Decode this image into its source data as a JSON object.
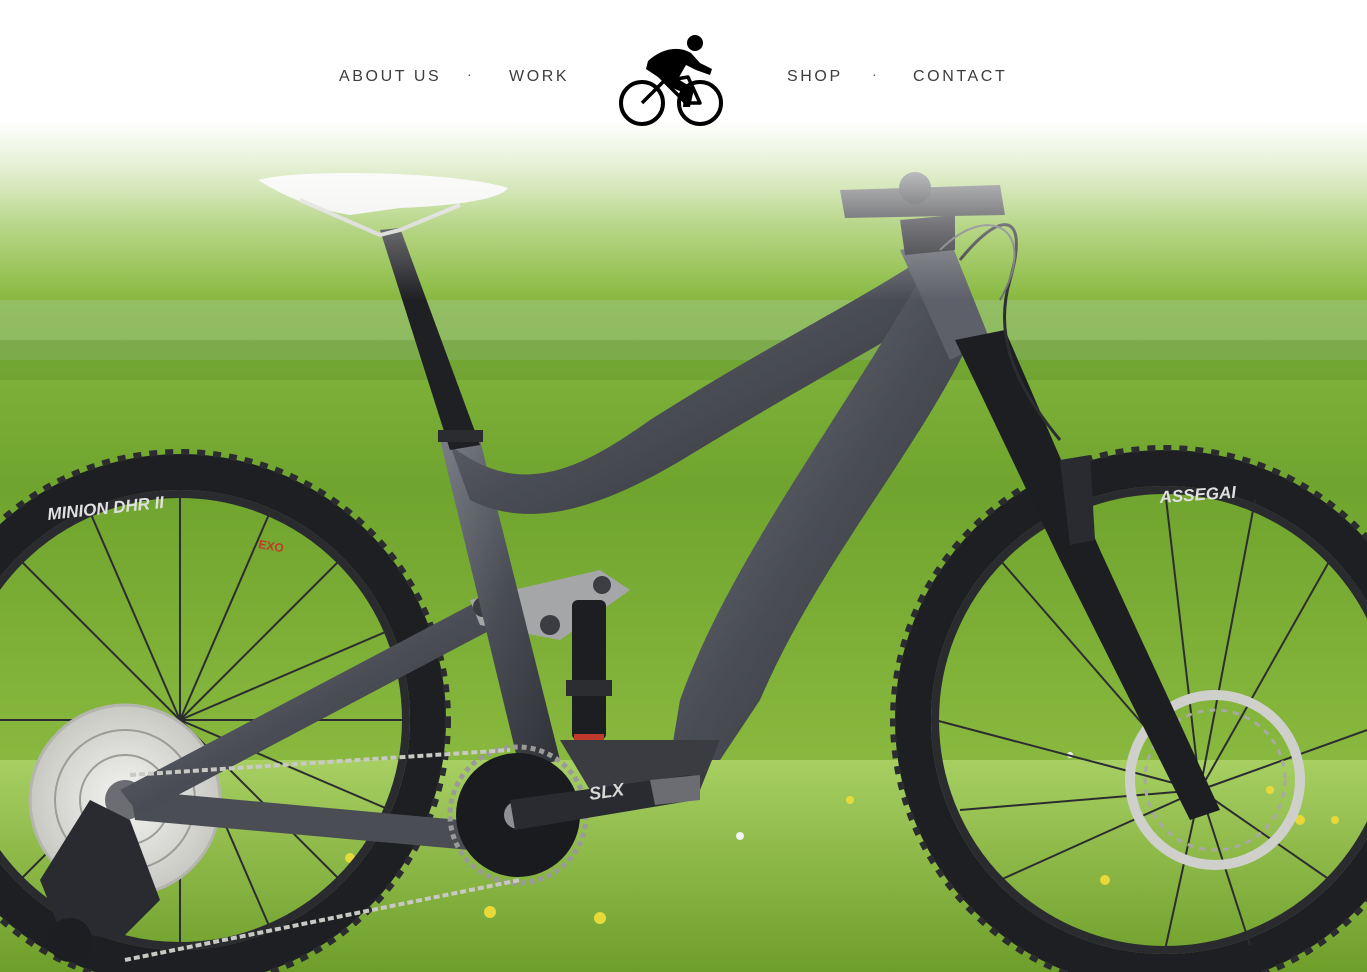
{
  "nav": {
    "items": [
      {
        "label": "ABOUT US"
      },
      {
        "label": "WORK"
      },
      {
        "label": "SHOP"
      },
      {
        "label": "CONTACT"
      }
    ],
    "separator": "·",
    "logo_icon": "cyclist-icon"
  },
  "hero": {
    "image_icon": "mountain-bike-photo",
    "tire_rear_label": "MINION DHR II",
    "tire_front_label": "ASSEGAI",
    "crank_label": "SLX"
  },
  "colors": {
    "nav_text": "#3d3d3d",
    "grass": "#7fae3a",
    "frame": "#55585f"
  }
}
